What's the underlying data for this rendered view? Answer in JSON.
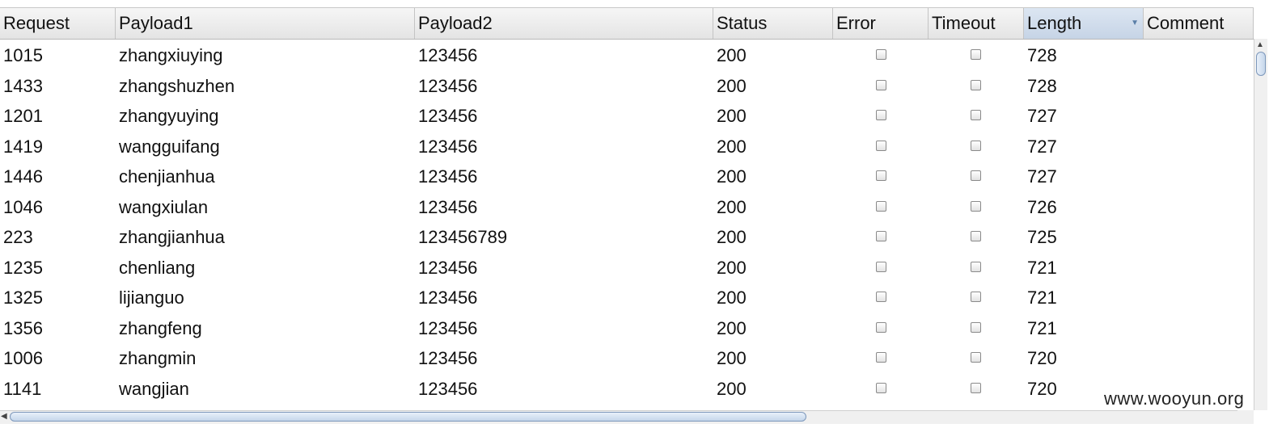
{
  "table": {
    "columns": [
      {
        "key": "request",
        "label": "Request"
      },
      {
        "key": "payload1",
        "label": "Payload1"
      },
      {
        "key": "payload2",
        "label": "Payload2"
      },
      {
        "key": "status",
        "label": "Status"
      },
      {
        "key": "error",
        "label": "Error"
      },
      {
        "key": "timeout",
        "label": "Timeout"
      },
      {
        "key": "length",
        "label": "Length",
        "sorted": "descending"
      },
      {
        "key": "comment",
        "label": "Comment"
      }
    ],
    "rows": [
      {
        "request": "1015",
        "payload1": "zhangxiuying",
        "payload2": "123456",
        "status": "200",
        "error": false,
        "timeout": false,
        "length": "728",
        "comment": ""
      },
      {
        "request": "1433",
        "payload1": "zhangshuzhen",
        "payload2": "123456",
        "status": "200",
        "error": false,
        "timeout": false,
        "length": "728",
        "comment": ""
      },
      {
        "request": "1201",
        "payload1": "zhangyuying",
        "payload2": "123456",
        "status": "200",
        "error": false,
        "timeout": false,
        "length": "727",
        "comment": ""
      },
      {
        "request": "1419",
        "payload1": "wangguifang",
        "payload2": "123456",
        "status": "200",
        "error": false,
        "timeout": false,
        "length": "727",
        "comment": ""
      },
      {
        "request": "1446",
        "payload1": "chenjianhua",
        "payload2": "123456",
        "status": "200",
        "error": false,
        "timeout": false,
        "length": "727",
        "comment": ""
      },
      {
        "request": "1046",
        "payload1": "wangxiulan",
        "payload2": "123456",
        "status": "200",
        "error": false,
        "timeout": false,
        "length": "726",
        "comment": ""
      },
      {
        "request": "223",
        "payload1": "zhangjianhua",
        "payload2": "123456789",
        "status": "200",
        "error": false,
        "timeout": false,
        "length": "725",
        "comment": ""
      },
      {
        "request": "1235",
        "payload1": "chenliang",
        "payload2": "123456",
        "status": "200",
        "error": false,
        "timeout": false,
        "length": "721",
        "comment": ""
      },
      {
        "request": "1325",
        "payload1": "lijianguo",
        "payload2": "123456",
        "status": "200",
        "error": false,
        "timeout": false,
        "length": "721",
        "comment": ""
      },
      {
        "request": "1356",
        "payload1": "zhangfeng",
        "payload2": "123456",
        "status": "200",
        "error": false,
        "timeout": false,
        "length": "721",
        "comment": ""
      },
      {
        "request": "1006",
        "payload1": "zhangmin",
        "payload2": "123456",
        "status": "200",
        "error": false,
        "timeout": false,
        "length": "720",
        "comment": ""
      },
      {
        "request": "1141",
        "payload1": "wangjian",
        "payload2": "123456",
        "status": "200",
        "error": false,
        "timeout": false,
        "length": "720",
        "comment": ""
      }
    ]
  },
  "icons": {
    "sort": "sort-descending-icon",
    "scroll_up": "arrow-up-icon",
    "scroll_left": "arrow-left-icon"
  },
  "watermark": "www.wooyun.org"
}
